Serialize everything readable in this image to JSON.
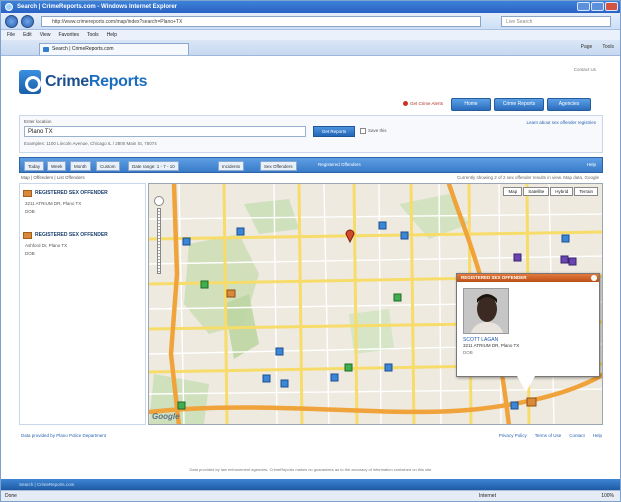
{
  "window": {
    "title": "Search | CrimeReports.com - Windows Internet Explorer",
    "address": "http://www.crimereports.com/map/index?search=Plano+TX",
    "search_placeholder": "Live Search",
    "menu": [
      "File",
      "Edit",
      "View",
      "Favorites",
      "Tools",
      "Help"
    ],
    "tab_title": "Search | CrimeReports.com",
    "tools": [
      "Page",
      "Tools"
    ]
  },
  "header": {
    "logo_prefix": "Crime",
    "logo_suffix": "Reports",
    "top_link": "Contact Us",
    "alert_link": "Get Crime Alerts",
    "buttons": [
      "Home",
      "Crime Reports",
      "Agencies"
    ]
  },
  "search": {
    "label": "Enter location",
    "value": "Plano TX",
    "go_label": "Get Reports",
    "checkbox_label": "Save this",
    "example": "Examples: 1100 Lincoln Avenue, Chicago IL / 2800 Main St, 75074",
    "right_link": "Learn about sex offender registries"
  },
  "filters": {
    "segments": [
      "Today",
      "Week",
      "Month",
      "Custom"
    ],
    "date_range": "Date range: 1 - 7 - 10",
    "incidents": "Incidents",
    "sex_offenders": "Sex Offenders",
    "note": "Registered Offenders",
    "help": "Help"
  },
  "subbar": {
    "left": "Map | Offenders | List Offenders",
    "right": "Currently showing 2 of 2 sex offender results in view. Map data, Google"
  },
  "list": [
    {
      "title": "REGISTERED SEX OFFENDER",
      "line1": "3211 ATRIUM DR, Plano TX",
      "line2": "DOB"
    },
    {
      "title": "REGISTERED SEX OFFENDER",
      "line1": "Ashford Dr, Plano TX",
      "line2": "DOB"
    }
  ],
  "map": {
    "types": [
      "Map",
      "Satellite",
      "Hybrid",
      "Terrain"
    ],
    "brand": "Google"
  },
  "popup": {
    "header": "REGISTERED SEX OFFENDER",
    "name": "SCOTT LAGAN",
    "address": "3211 ATRIUM DR, Plano TX",
    "small": "DOB"
  },
  "footer": {
    "left": "Data provided by Plano Police Department",
    "right": [
      "Privacy Policy",
      "Terms of Use",
      "Contact",
      "Help"
    ],
    "disclaimer": "Data provided by law enforcement agencies. CrimeReports makes no guarantees as to the accuracy of information contained on this site."
  },
  "status": {
    "done": "Done",
    "zone": "Internet",
    "zoom": "100%"
  },
  "colors": {
    "accent": "#2c6dbd",
    "popup_header": "#d05f23"
  }
}
